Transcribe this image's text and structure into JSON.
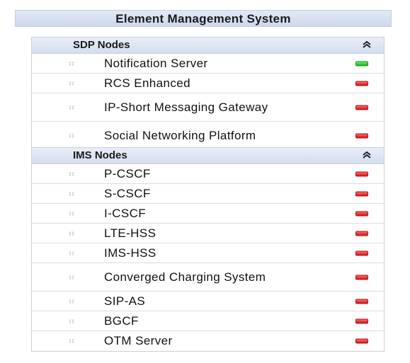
{
  "app_title": "Element Management System",
  "colors": {
    "status_up": "#22c022",
    "status_down": "#dd2222",
    "header_bg": "#d4deef"
  },
  "panels": [
    {
      "name": "SDP Nodes",
      "collapse_icon": "chevron-double-up-icon",
      "items": [
        {
          "label": "Notification Server",
          "status": "up"
        },
        {
          "label": "RCS Enhanced",
          "status": "down"
        },
        {
          "label": "IP-Short Messaging Gateway",
          "status": "down"
        },
        {
          "label": "Social Networking Platform",
          "status": "down"
        }
      ]
    },
    {
      "name": "IMS Nodes",
      "collapse_icon": "chevron-double-up-icon",
      "items": [
        {
          "label": "P-CSCF",
          "status": "down"
        },
        {
          "label": "S-CSCF",
          "status": "down"
        },
        {
          "label": "I-CSCF",
          "status": "down"
        },
        {
          "label": "LTE-HSS",
          "status": "down"
        },
        {
          "label": "IMS-HSS",
          "status": "down"
        },
        {
          "label": "Converged Charging System",
          "status": "down"
        },
        {
          "label": "SIP-AS",
          "status": "down"
        },
        {
          "label": "BGCF",
          "status": "down"
        },
        {
          "label": "OTM Server",
          "status": "down"
        }
      ]
    }
  ]
}
